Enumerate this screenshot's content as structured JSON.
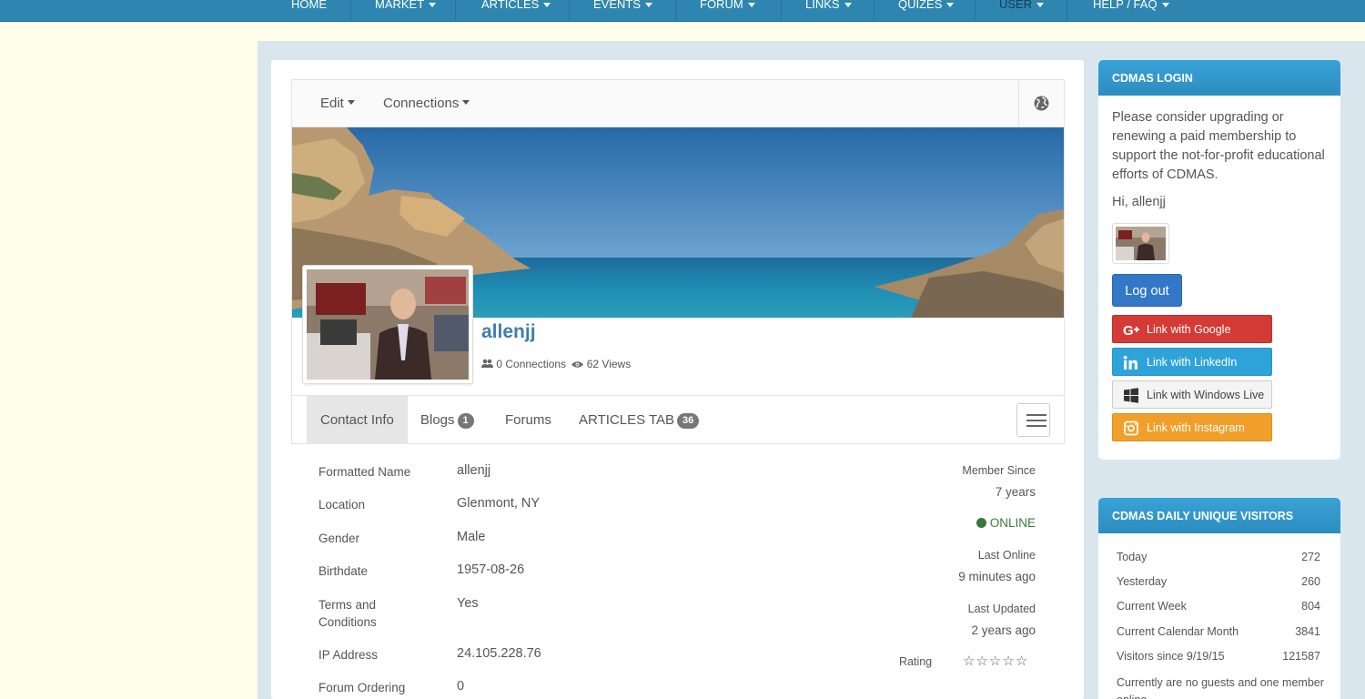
{
  "nav": {
    "items": [
      "HOME",
      "MARKET",
      "ARTICLES",
      "EVENTS",
      "FORUM",
      "LINKS",
      "QUIZES",
      "USER",
      "HELP / FAQ"
    ]
  },
  "profile": {
    "toolbar": {
      "edit": "Edit",
      "connections": "Connections"
    },
    "username": "allenjj",
    "connections": "0 Connections",
    "views": "62 Views",
    "tabs": [
      {
        "label": "Contact Info"
      },
      {
        "label": "Blogs",
        "badge": "1"
      },
      {
        "label": "Forums"
      },
      {
        "label": "ARTICLES TAB",
        "badge": "36"
      }
    ],
    "fields": [
      {
        "label": "Formatted Name",
        "value": "allenjj"
      },
      {
        "label": "Location",
        "value": "Glenmont, NY"
      },
      {
        "label": "Gender",
        "value": "Male"
      },
      {
        "label": "Birthdate",
        "value": "1957-08-26"
      },
      {
        "label": "Terms and Conditions",
        "value": "Yes"
      },
      {
        "label": "IP Address",
        "value": "24.105.228.76"
      },
      {
        "label": "Forum Ordering",
        "value": "0"
      }
    ],
    "meta": {
      "member_since_label": "Member Since",
      "member_since_value": "7 years",
      "status": "ONLINE",
      "last_online_label": "Last Online",
      "last_online_value": "9 minutes ago",
      "last_updated_label": "Last Updated",
      "last_updated_value": "2 years ago",
      "rating_label": "Rating",
      "rating_value": 0,
      "rating_max": 5
    }
  },
  "login": {
    "title": "CDMAS LOGIN",
    "message": "Please consider upgrading or renewing a paid membership to support the not-for-profit educational efforts of CDMAS.",
    "greeting": "Hi, allenjj",
    "logout": "Log out",
    "social": {
      "google": "Link with Google",
      "linkedin": "Link with LinkedIn",
      "windows": "Link with Windows Live",
      "instagram": "Link with Instagram"
    }
  },
  "visitors": {
    "title": "CDMAS DAILY UNIQUE VISITORS",
    "rows": [
      {
        "label": "Today",
        "value": "272"
      },
      {
        "label": "Yesterday",
        "value": "260"
      },
      {
        "label": "Current Week",
        "value": "804"
      },
      {
        "label": "Current Calendar Month",
        "value": "3841"
      },
      {
        "label": "Visitors since 9/19/15",
        "value": "121587"
      }
    ],
    "footer": "Currently are no guests and one member online"
  },
  "colors": {
    "nav_bg": "#2e86b0",
    "accent": "#3378c6",
    "online": "#3d763d",
    "google": "#d43b36",
    "linkedin": "#2ea3da",
    "instagram": "#f0a02a"
  }
}
